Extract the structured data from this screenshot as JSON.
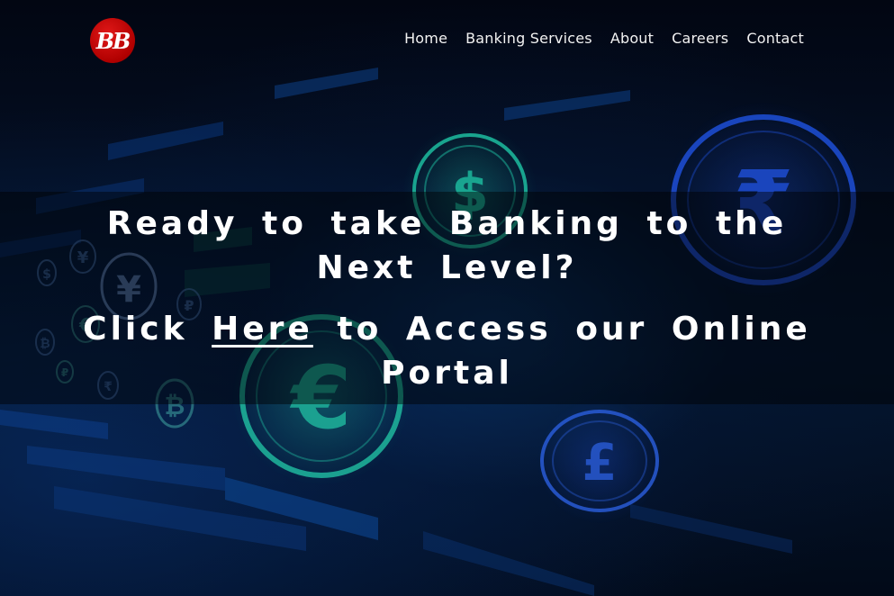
{
  "brand": {
    "logo_text": "BB",
    "logo_color": "#b00000"
  },
  "nav": {
    "items": [
      {
        "label": "Home"
      },
      {
        "label": "Banking Services"
      },
      {
        "label": "About"
      },
      {
        "label": "Careers"
      },
      {
        "label": "Contact"
      }
    ]
  },
  "hero": {
    "headline": "Ready to take Banking to the Next Level?",
    "cta_prefix": "Click",
    "cta_link": "Here",
    "cta_suffix": "to Access our Online Portal",
    "background_symbols": [
      "$",
      "€",
      "£",
      "¥",
      "₹",
      "฿",
      "₽"
    ]
  },
  "colors": {
    "text": "#ffffff",
    "banner_overlay": "rgba(0,0,0,0.45)",
    "teal": "#1fc9a8",
    "blue": "#1e4fd8"
  }
}
